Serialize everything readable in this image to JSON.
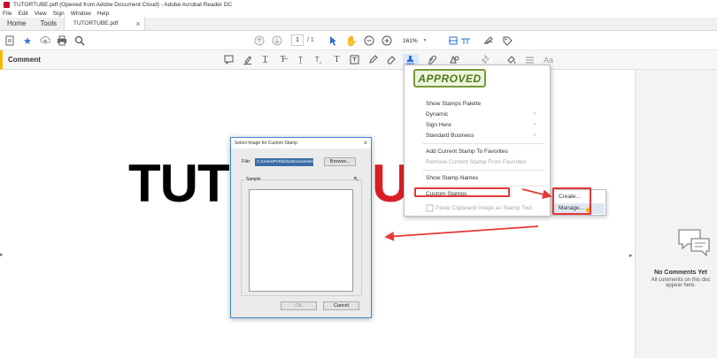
{
  "window": {
    "title": "TUTORTUBE.pdf (Opened from Adobe Document Cloud) - Adobe Acrobat Reader DC"
  },
  "menubar": [
    "File",
    "Edit",
    "View",
    "Sign",
    "Window",
    "Help"
  ],
  "tabs": {
    "home": "Home",
    "tools": "Tools",
    "document": "TUTORTUBE.pdf",
    "close_glyph": "×"
  },
  "toolbar": {
    "page_current": "1",
    "page_total": "/ 1",
    "zoom": "161%"
  },
  "comment_bar": {
    "label": "Comment"
  },
  "document": {
    "text_black": "TUT",
    "text_red": "U"
  },
  "dialog": {
    "title": "Select Image for Custom Stamp",
    "file_label": "File:",
    "file_value": "C:\\Users\\PARiksha\\Documents\\",
    "browse": "Browse...",
    "sample_label": "Sample",
    "ok": "OK",
    "cancel": "Cancel"
  },
  "stamp_menu": {
    "approved_stamp": "APPROVED",
    "items": [
      {
        "label": "Show Stamps Palette",
        "disabled": false
      },
      {
        "label": "Dynamic",
        "disabled": false,
        "submenu": true
      },
      {
        "label": "Sign Here",
        "disabled": false,
        "submenu": true
      },
      {
        "label": "Standard Business",
        "disabled": false,
        "submenu": true
      },
      {
        "label": "Add Current Stamp To Favorites",
        "disabled": false
      },
      {
        "label": "Remove Current Stamp From Favorites",
        "disabled": true
      },
      {
        "label": "Show Stamp Names",
        "disabled": false
      },
      {
        "label": "Custom Stamps",
        "disabled": false,
        "submenu": true
      },
      {
        "label": "Paste Clipboard Image as Stamp Tool",
        "disabled": true
      }
    ]
  },
  "submenu": {
    "create": "Create...",
    "manage": "Manage..."
  },
  "right_panel": {
    "no_comments": "No Comments Yet",
    "hint_line1": "All comments on this doc",
    "hint_line2": "appear here."
  },
  "colors": {
    "annotation_red": "#e53935",
    "accent_yellow": "#f5b800",
    "brand_red": "#c8102e",
    "stamp_green": "#4d7a17"
  },
  "icons": [
    "create-pdf-icon",
    "star-icon",
    "upload-icon",
    "print-icon",
    "search-icon",
    "arrow-up-icon",
    "arrow-down-icon",
    "select-cursor-icon",
    "hand-icon",
    "zoom-out-icon",
    "zoom-in-icon",
    "fit-page-icon",
    "comment-icon",
    "stamp-icon"
  ]
}
